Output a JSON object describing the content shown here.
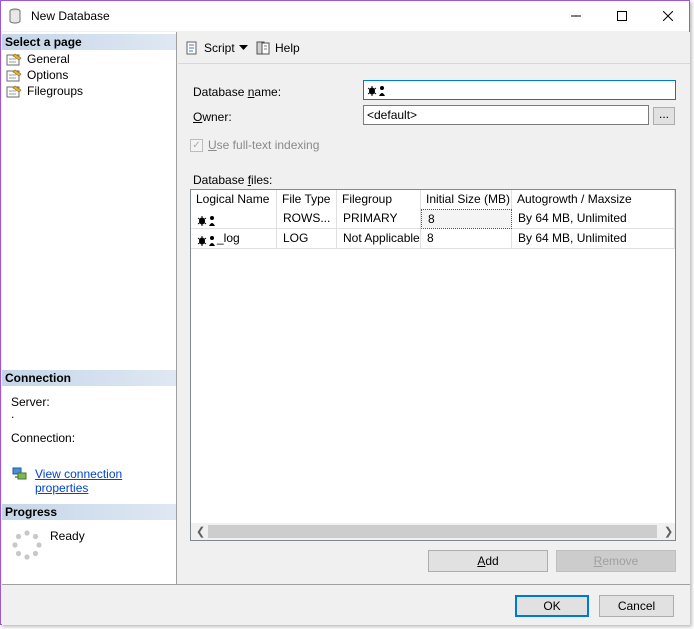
{
  "window": {
    "title": "New Database"
  },
  "left": {
    "select_page": {
      "header": "Select a page",
      "items": [
        {
          "label": "General",
          "icon": "page-wrench-icon"
        },
        {
          "label": "Options",
          "icon": "page-wrench-icon"
        },
        {
          "label": "Filegroups",
          "icon": "page-wrench-icon"
        }
      ]
    },
    "connection": {
      "header": "Connection",
      "server_label": "Server:",
      "server_value": ".",
      "connection_label": "Connection:",
      "view_link": "View connection properties"
    },
    "progress": {
      "header": "Progress",
      "status": "Ready"
    }
  },
  "toolbar": {
    "script_label": "Script",
    "help_label": "Help"
  },
  "form": {
    "db_name_label_pre": "Database ",
    "db_name_label_u": "n",
    "db_name_label_post": "ame:",
    "db_name_value": "",
    "owner_label_u": "O",
    "owner_label_post": "wner:",
    "owner_value": "<default>",
    "ellipsis": "...",
    "fulltext_u": "U",
    "fulltext_post": "se full-text indexing",
    "db_files_pre": "Database ",
    "db_files_u": "f",
    "db_files_post": "iles:"
  },
  "grid": {
    "columns": [
      "Logical Name",
      "File Type",
      "Filegroup",
      "Initial Size (MB)",
      "Autogrowth / Maxsize"
    ],
    "rows": [
      {
        "logical_name": "",
        "file_type": "ROWS...",
        "filegroup": "PRIMARY",
        "initial_size": "8",
        "autogrowth": "By 64 MB, Unlimited"
      },
      {
        "logical_name": "_log",
        "file_type": "LOG",
        "filegroup": "Not Applicable",
        "initial_size": "8",
        "autogrowth": "By 64 MB, Unlimited"
      }
    ]
  },
  "buttons": {
    "add_u": "A",
    "add_post": "dd",
    "remove_u": "R",
    "remove_post": "emove",
    "ok": "OK",
    "cancel": "Cancel"
  }
}
